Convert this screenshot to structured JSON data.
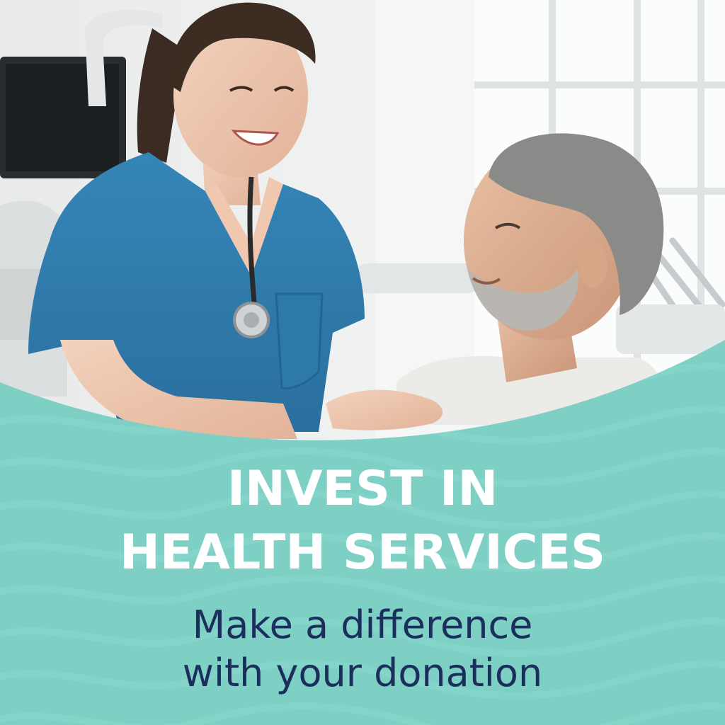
{
  "poster": {
    "headline_line1": "INVEST IN",
    "headline_line2": "HEALTH SERVICES",
    "subline_line1": "Make a difference",
    "subline_line2": "with your donation"
  },
  "colors": {
    "panel_teal": "#7ecfc4",
    "headline_white": "#ffffff",
    "subline_navy": "#1b2f5c",
    "scrubs_blue": "#2f7fb0"
  },
  "image": {
    "subject": "nurse-and-patient-photo"
  }
}
